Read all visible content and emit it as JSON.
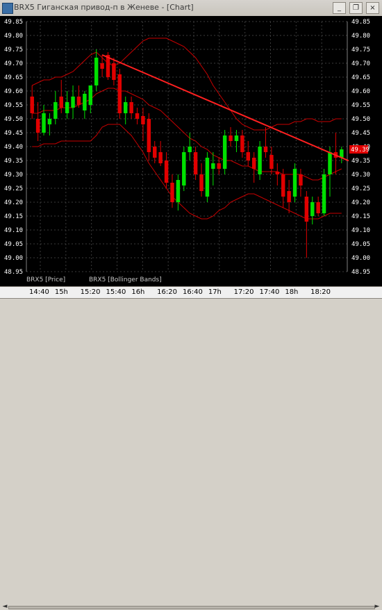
{
  "window": {
    "title": "BRX5 Гиганская привод-п в Женеве - [Chart]",
    "minimize_glyph": "_",
    "restore_glyph": "❐",
    "close_glyph": "×"
  },
  "colors": {
    "background": "#000000",
    "bull": "#00e100",
    "bear": "#e10000",
    "band": "#c80000",
    "trend": "#ff2020",
    "grid": "#3c3c3c",
    "axis_text": "#ffffff",
    "price_tag_bg": "#e10000"
  },
  "legend": {
    "price": "BRX5 [Price]",
    "bands": "BRX5 [Bollinger Bands]"
  },
  "timeline": {
    "labels": [
      "14:40",
      "15h",
      "15:20",
      "15:40",
      "16h",
      "16:20",
      "16:40",
      "17h",
      "17:20",
      "17:40",
      "18h",
      "18:20"
    ]
  },
  "current_price": "49.39",
  "chart_data": {
    "type": "candlestick",
    "title": "",
    "ylim": [
      48.95,
      49.85
    ],
    "y_ticks": [
      49.85,
      49.8,
      49.75,
      49.7,
      49.65,
      49.6,
      49.55,
      49.5,
      49.45,
      49.4,
      49.35,
      49.3,
      49.25,
      49.2,
      49.15,
      49.1,
      49.05,
      49.0,
      48.95
    ],
    "y_tick_labels": [
      "49.85",
      "49.80",
      "49.75",
      "49.70",
      "49.65",
      "49.60",
      "49.55",
      "49.50",
      "49.45",
      "49.40",
      "49.35",
      "49.30",
      "49.25",
      "49.20",
      "49.15",
      "49.10",
      "49.05",
      "49.00",
      "48.95"
    ],
    "candles": [
      {
        "o": 49.58,
        "h": 49.62,
        "l": 49.5,
        "c": 49.52
      },
      {
        "o": 49.5,
        "h": 49.56,
        "l": 49.42,
        "c": 49.45
      },
      {
        "o": 49.45,
        "h": 49.55,
        "l": 49.44,
        "c": 49.52
      },
      {
        "o": 49.48,
        "h": 49.52,
        "l": 49.44,
        "c": 49.5
      },
      {
        "o": 49.5,
        "h": 49.6,
        "l": 49.48,
        "c": 49.56
      },
      {
        "o": 49.58,
        "h": 49.64,
        "l": 49.52,
        "c": 49.54
      },
      {
        "o": 49.52,
        "h": 49.6,
        "l": 49.5,
        "c": 49.56
      },
      {
        "o": 49.54,
        "h": 49.62,
        "l": 49.5,
        "c": 49.58
      },
      {
        "o": 49.58,
        "h": 49.62,
        "l": 49.54,
        "c": 49.55
      },
      {
        "o": 49.53,
        "h": 49.6,
        "l": 49.5,
        "c": 49.59
      },
      {
        "o": 49.55,
        "h": 49.62,
        "l": 49.52,
        "c": 49.62
      },
      {
        "o": 49.62,
        "h": 49.75,
        "l": 49.6,
        "c": 49.72
      },
      {
        "o": 49.7,
        "h": 49.73,
        "l": 49.65,
        "c": 49.68
      },
      {
        "o": 49.73,
        "h": 49.74,
        "l": 49.64,
        "c": 49.65
      },
      {
        "o": 49.7,
        "h": 49.72,
        "l": 49.62,
        "c": 49.64
      },
      {
        "o": 49.66,
        "h": 49.68,
        "l": 49.5,
        "c": 49.52
      },
      {
        "o": 49.52,
        "h": 49.58,
        "l": 49.48,
        "c": 49.56
      },
      {
        "o": 49.56,
        "h": 49.58,
        "l": 49.5,
        "c": 49.52
      },
      {
        "o": 49.52,
        "h": 49.54,
        "l": 49.48,
        "c": 49.5
      },
      {
        "o": 49.51,
        "h": 49.54,
        "l": 49.42,
        "c": 49.48
      },
      {
        "o": 49.5,
        "h": 49.52,
        "l": 49.35,
        "c": 49.38
      },
      {
        "o": 49.4,
        "h": 49.42,
        "l": 49.34,
        "c": 49.36
      },
      {
        "o": 49.38,
        "h": 49.42,
        "l": 49.33,
        "c": 49.34
      },
      {
        "o": 49.35,
        "h": 49.38,
        "l": 49.25,
        "c": 49.27
      },
      {
        "o": 49.27,
        "h": 49.3,
        "l": 49.18,
        "c": 49.2
      },
      {
        "o": 49.2,
        "h": 49.3,
        "l": 49.17,
        "c": 49.28
      },
      {
        "o": 49.26,
        "h": 49.4,
        "l": 49.24,
        "c": 49.38
      },
      {
        "o": 49.38,
        "h": 49.45,
        "l": 49.35,
        "c": 49.4
      },
      {
        "o": 49.38,
        "h": 49.4,
        "l": 49.28,
        "c": 49.3
      },
      {
        "o": 49.3,
        "h": 49.34,
        "l": 49.22,
        "c": 49.24
      },
      {
        "o": 49.22,
        "h": 49.38,
        "l": 49.2,
        "c": 49.36
      },
      {
        "o": 49.32,
        "h": 49.38,
        "l": 49.26,
        "c": 49.34
      },
      {
        "o": 49.34,
        "h": 49.36,
        "l": 49.3,
        "c": 49.32
      },
      {
        "o": 49.32,
        "h": 49.46,
        "l": 49.3,
        "c": 49.44
      },
      {
        "o": 49.44,
        "h": 49.47,
        "l": 49.4,
        "c": 49.42
      },
      {
        "o": 49.42,
        "h": 49.46,
        "l": 49.38,
        "c": 49.44
      },
      {
        "o": 49.44,
        "h": 49.46,
        "l": 49.36,
        "c": 49.38
      },
      {
        "o": 49.38,
        "h": 49.42,
        "l": 49.33,
        "c": 49.35
      },
      {
        "o": 49.36,
        "h": 49.38,
        "l": 49.27,
        "c": 49.32
      },
      {
        "o": 49.3,
        "h": 49.42,
        "l": 49.28,
        "c": 49.4
      },
      {
        "o": 49.4,
        "h": 49.47,
        "l": 49.36,
        "c": 49.38
      },
      {
        "o": 49.37,
        "h": 49.4,
        "l": 49.3,
        "c": 49.32
      },
      {
        "o": 49.31,
        "h": 49.34,
        "l": 49.26,
        "c": 49.3
      },
      {
        "o": 49.3,
        "h": 49.32,
        "l": 49.18,
        "c": 49.22
      },
      {
        "o": 49.24,
        "h": 49.28,
        "l": 49.16,
        "c": 49.2
      },
      {
        "o": 49.22,
        "h": 49.34,
        "l": 49.2,
        "c": 49.32
      },
      {
        "o": 49.3,
        "h": 49.32,
        "l": 49.22,
        "c": 49.26
      },
      {
        "o": 49.22,
        "h": 49.24,
        "l": 49.0,
        "c": 49.13
      },
      {
        "o": 49.15,
        "h": 49.22,
        "l": 49.12,
        "c": 49.2
      },
      {
        "o": 49.2,
        "h": 49.22,
        "l": 49.15,
        "c": 49.16
      },
      {
        "o": 49.16,
        "h": 49.32,
        "l": 49.15,
        "c": 49.3
      },
      {
        "o": 49.3,
        "h": 49.4,
        "l": 49.22,
        "c": 49.38
      },
      {
        "o": 49.38,
        "h": 49.45,
        "l": 49.3,
        "c": 49.36
      },
      {
        "o": 49.36,
        "h": 49.4,
        "l": 49.34,
        "c": 49.39
      }
    ],
    "bollinger_upper": [
      49.62,
      49.63,
      49.64,
      49.64,
      49.65,
      49.65,
      49.66,
      49.67,
      49.69,
      49.71,
      49.73,
      49.74,
      49.72,
      49.7,
      49.69,
      49.7,
      49.72,
      49.74,
      49.76,
      49.78,
      49.79,
      49.79,
      49.79,
      49.79,
      49.78,
      49.77,
      49.76,
      49.74,
      49.72,
      49.69,
      49.66,
      49.62,
      49.59,
      49.56,
      49.53,
      49.5,
      49.48,
      49.47,
      49.46,
      49.46,
      49.46,
      49.47,
      49.48,
      49.48,
      49.48,
      49.49,
      49.49,
      49.5,
      49.5,
      49.49,
      49.49,
      49.49,
      49.5,
      49.5
    ],
    "bollinger_mid": [
      49.52,
      49.52,
      49.53,
      49.53,
      49.53,
      49.54,
      49.54,
      49.54,
      49.55,
      49.56,
      49.57,
      49.59,
      49.6,
      49.61,
      49.61,
      49.6,
      49.6,
      49.59,
      49.58,
      49.57,
      49.55,
      49.54,
      49.53,
      49.51,
      49.49,
      49.47,
      49.45,
      49.43,
      49.42,
      49.4,
      49.39,
      49.37,
      49.36,
      49.35,
      49.35,
      49.34,
      49.33,
      49.33,
      49.32,
      49.31,
      49.31,
      49.31,
      49.31,
      49.3,
      49.3,
      49.3,
      49.3,
      49.29,
      49.28,
      49.28,
      49.29,
      49.3,
      49.31,
      49.32
    ],
    "bollinger_lower": [
      49.4,
      49.4,
      49.41,
      49.41,
      49.41,
      49.42,
      49.42,
      49.42,
      49.42,
      49.42,
      49.42,
      49.44,
      49.47,
      49.48,
      49.48,
      49.48,
      49.46,
      49.44,
      49.41,
      49.38,
      49.34,
      49.31,
      49.28,
      49.25,
      49.22,
      49.2,
      49.18,
      49.16,
      49.15,
      49.14,
      49.14,
      49.15,
      49.17,
      49.18,
      49.2,
      49.21,
      49.22,
      49.23,
      49.23,
      49.22,
      49.21,
      49.2,
      49.19,
      49.18,
      49.17,
      49.16,
      49.15,
      49.14,
      49.14,
      49.14,
      49.15,
      49.16,
      49.16,
      49.16
    ],
    "trendline": {
      "from": {
        "index": 12,
        "price": 49.73
      },
      "to": {
        "index": 53,
        "price": 49.36
      }
    }
  }
}
